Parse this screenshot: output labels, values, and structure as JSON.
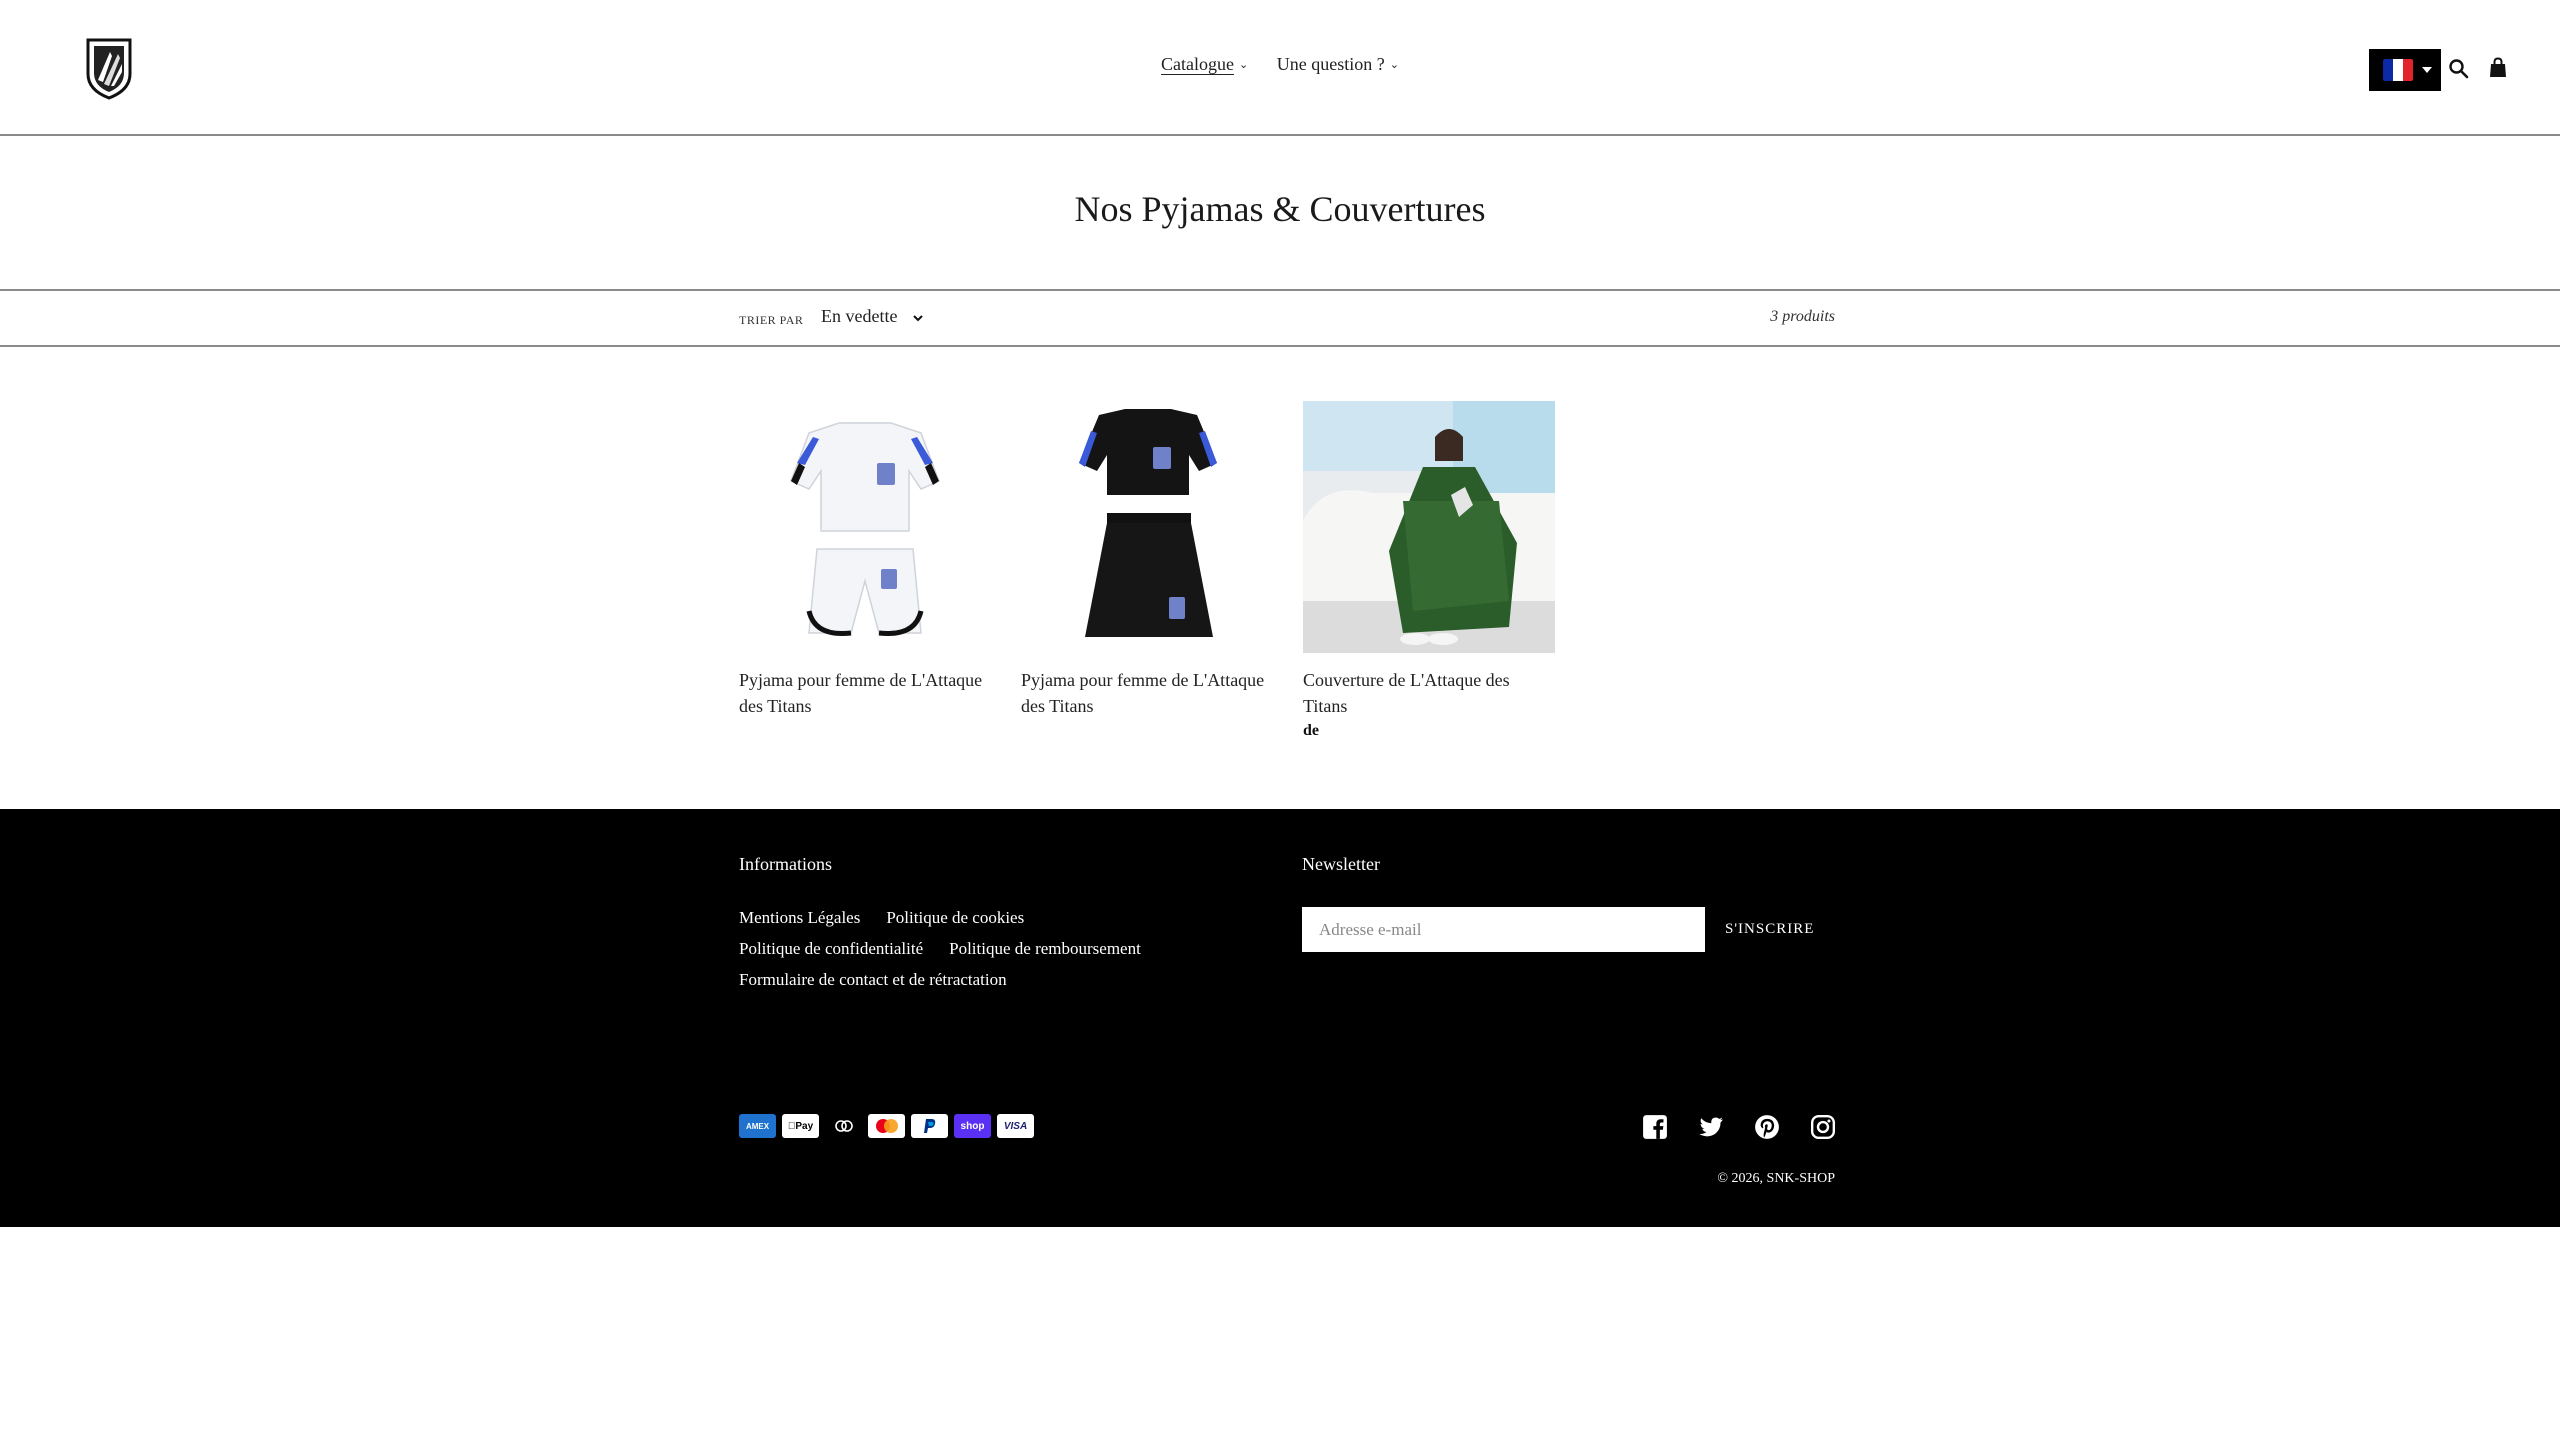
{
  "header": {
    "nav": [
      {
        "label": "Catalogue",
        "active": true
      },
      {
        "label": "Une question ?",
        "active": false
      }
    ],
    "language_flag": "FR",
    "icons": [
      "search-icon",
      "cart-icon"
    ]
  },
  "collection": {
    "title": "Nos Pyjamas & Couvertures",
    "sort_label": "TRIER PAR",
    "sort_value": "En vedette",
    "count": "3 produits"
  },
  "products": [
    {
      "title": "Pyjama pour femme de L'Attaque des Titans",
      "price": ""
    },
    {
      "title": "Pyjama pour femme de L'Attaque des Titans",
      "price": ""
    },
    {
      "title": "Couverture de L'Attaque des Titans",
      "price": "de"
    }
  ],
  "footer": {
    "info_heading": "Informations",
    "links": [
      "Mentions Légales",
      "Politique de cookies",
      "Politique de confidentialité",
      "Politique de remboursement",
      "Formulaire de contact et de rétractation"
    ],
    "newsletter_heading": "Newsletter",
    "email_placeholder": "Adresse e-mail",
    "subscribe_label": "S'INSCRIRE",
    "payments": [
      "American Express",
      "Apple Pay",
      "Diners Club",
      "Mastercard",
      "PayPal",
      "Shop Pay",
      "Visa"
    ],
    "payment_labels": {
      "amex": "AMEX",
      "apple": "Pay",
      "shop": "shop",
      "visa": "VISA"
    },
    "socials": [
      "facebook-icon",
      "twitter-icon",
      "pinterest-icon",
      "instagram-icon"
    ],
    "copyright_prefix": "© 2026,",
    "copyright_brand": "SNK-SHOP"
  },
  "colors": {
    "footer_bg": "#000000",
    "border": "#8a8a8a",
    "flag_blue": "#0c2aa6",
    "flag_red": "#e1242b"
  }
}
